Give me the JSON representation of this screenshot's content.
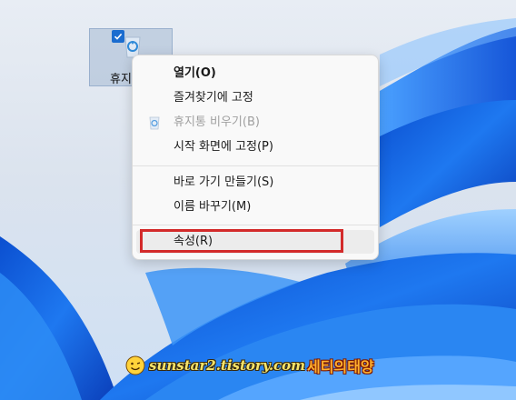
{
  "desktop": {
    "icon": {
      "label": "휴지통",
      "icon_name": "recycle-bin-icon",
      "checked": true
    }
  },
  "context_menu": {
    "groups": [
      [
        {
          "label": "열기(O)",
          "bold": true,
          "enabled": true
        },
        {
          "label": "즐겨찾기에 고정",
          "enabled": true
        },
        {
          "label": "휴지통 비우기(B)",
          "enabled": false,
          "icon": "recycle-bin-icon"
        },
        {
          "label": "시작 화면에 고정(P)",
          "enabled": true
        }
      ],
      [
        {
          "label": "바로 가기 만들기(S)",
          "enabled": true
        },
        {
          "label": "이름 바꾸기(M)",
          "enabled": true
        }
      ],
      [
        {
          "label": "속성(R)",
          "enabled": true,
          "highlighted": true
        }
      ]
    ]
  },
  "watermark": {
    "domain": "sunstar2.tistory.com",
    "brand": "세티의태양"
  },
  "colors": {
    "highlight_border": "#d32a2a",
    "wallpaper_blue": "#1e6ee8",
    "check_blue": "#1a6ccf"
  }
}
